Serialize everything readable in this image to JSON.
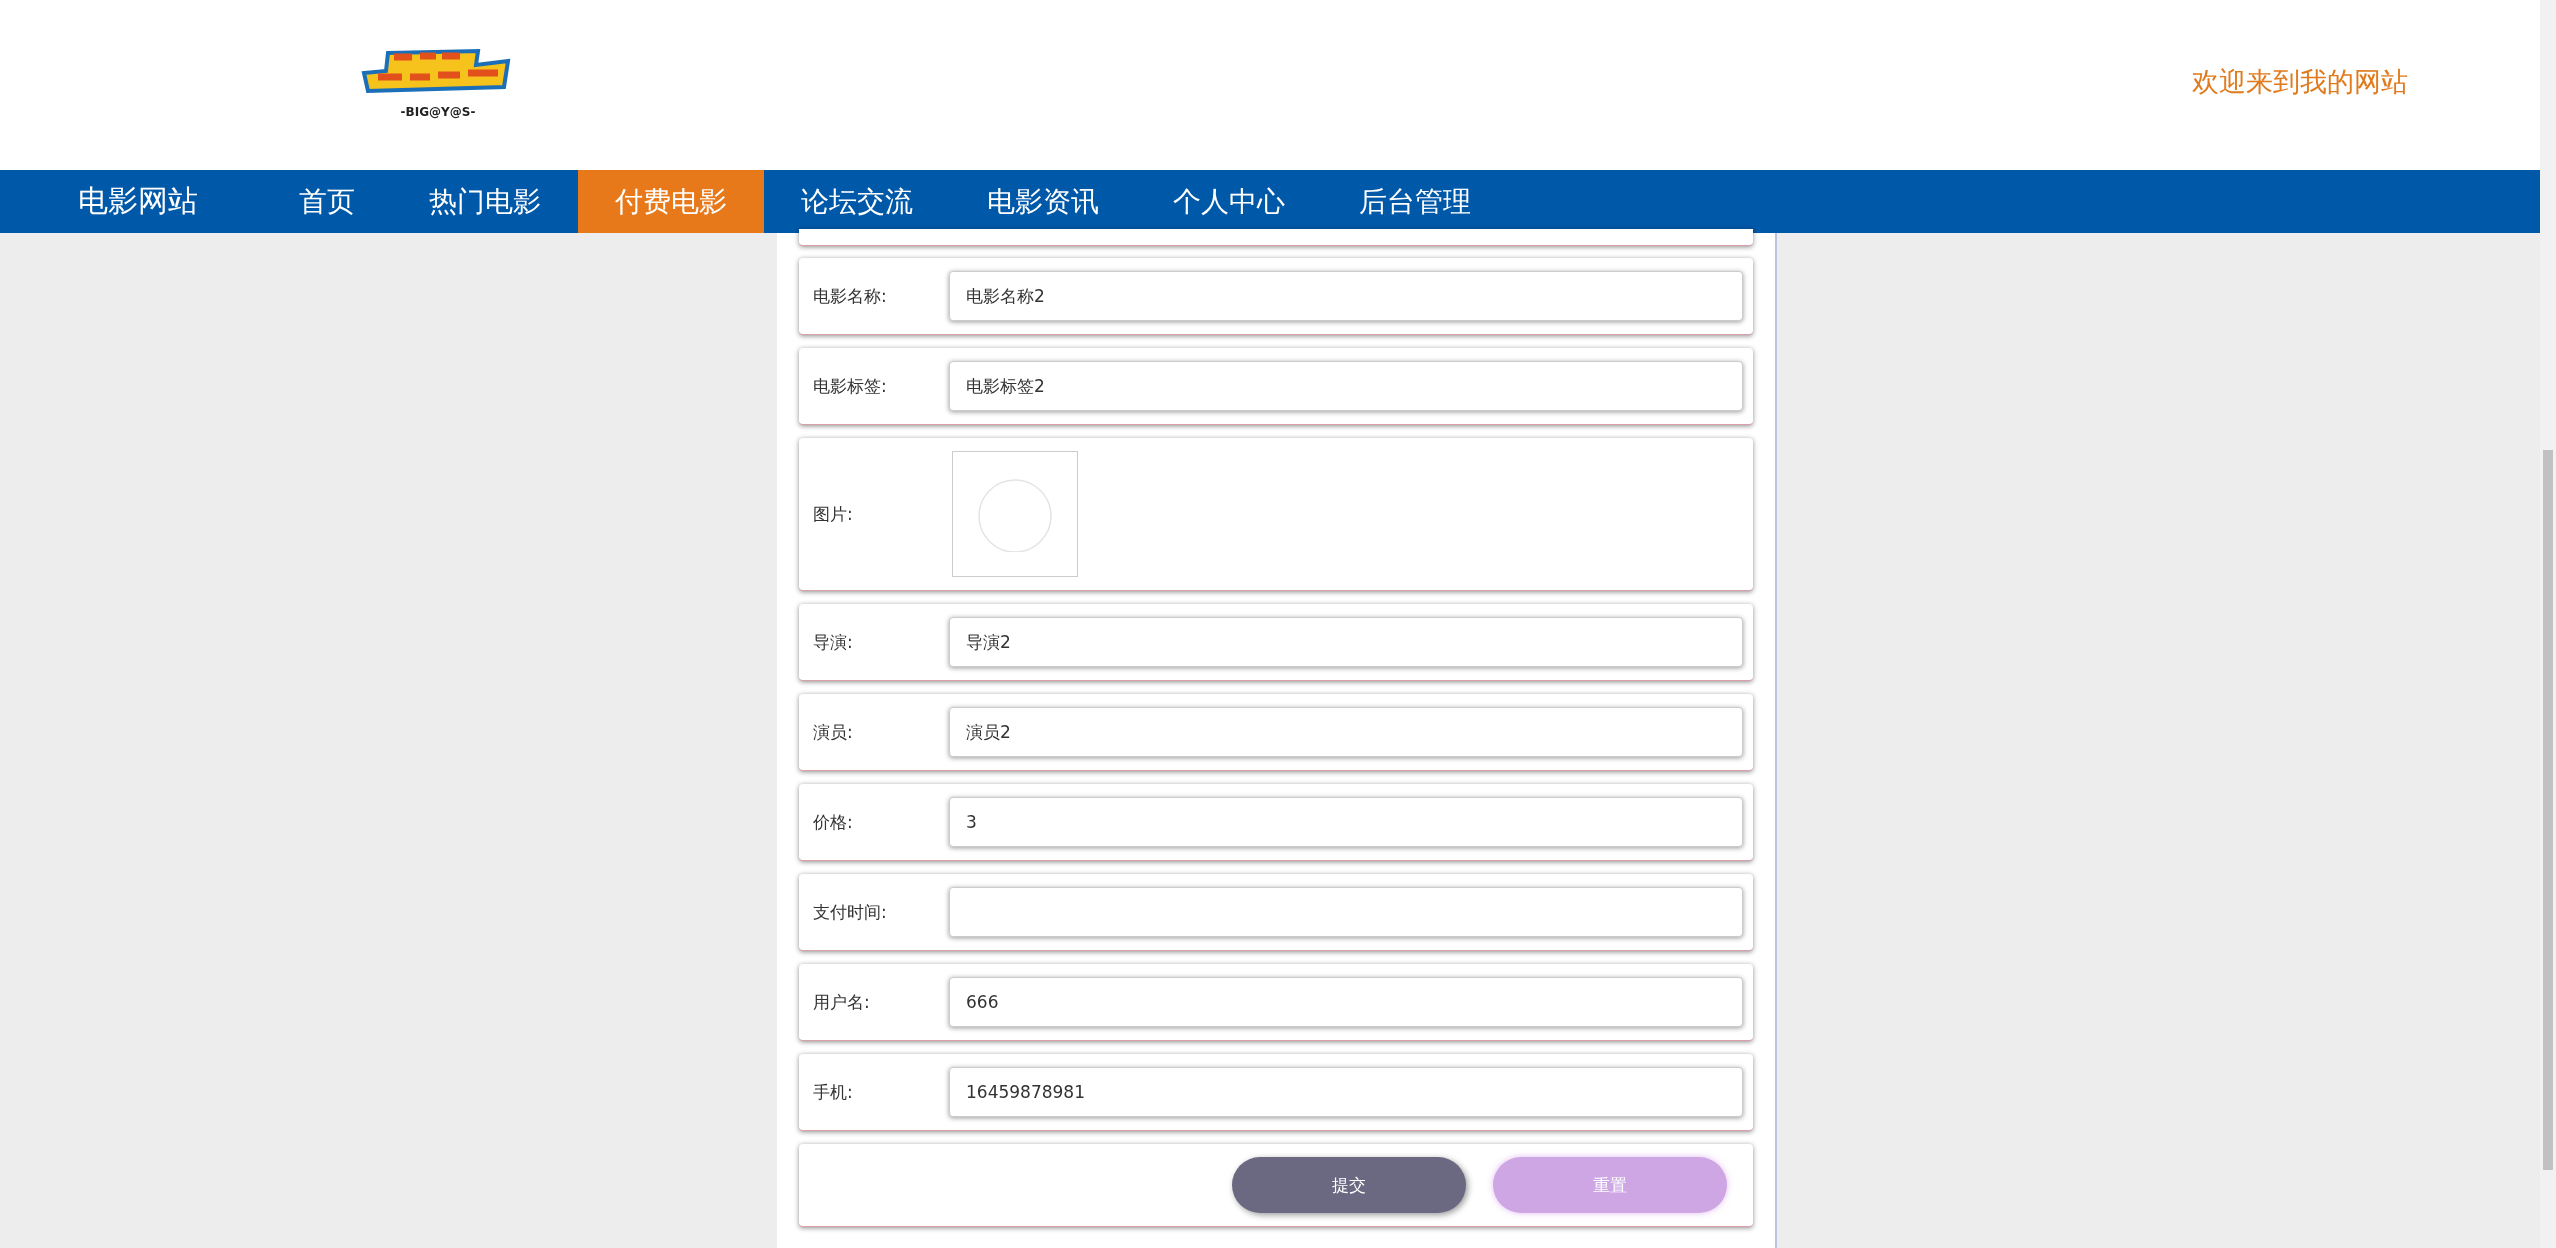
{
  "header": {
    "logo_caption": "-BIG@Y@S-",
    "welcome": "欢迎来到我的网站"
  },
  "nav": {
    "brand": "电影网站",
    "items": [
      {
        "label": "首页",
        "selected": false
      },
      {
        "label": "热门电影",
        "selected": false
      },
      {
        "label": "付费电影",
        "selected": true
      },
      {
        "label": "论坛交流",
        "selected": false
      },
      {
        "label": "电影资讯",
        "selected": false
      },
      {
        "label": "个人中心",
        "selected": false
      },
      {
        "label": "后台管理",
        "selected": false
      }
    ]
  },
  "form": {
    "fields": [
      {
        "kind": "text",
        "label": "电影名称:",
        "value": "电影名称2"
      },
      {
        "kind": "text",
        "label": "电影标签:",
        "value": "电影标签2"
      },
      {
        "kind": "image",
        "label": "图片:"
      },
      {
        "kind": "text",
        "label": "导演:",
        "value": "导演2"
      },
      {
        "kind": "text",
        "label": "演员:",
        "value": "演员2"
      },
      {
        "kind": "text",
        "label": "价格:",
        "value": "3"
      },
      {
        "kind": "text",
        "label": "支付时间:"
      },
      {
        "kind": "text",
        "label": "用户名:",
        "value": "666"
      },
      {
        "kind": "text",
        "label": "手机:",
        "value": "16459878981"
      }
    ],
    "buttons": [
      {
        "kind": "submit",
        "label": "提交"
      },
      {
        "kind": "reset",
        "label": "重置"
      }
    ]
  }
}
